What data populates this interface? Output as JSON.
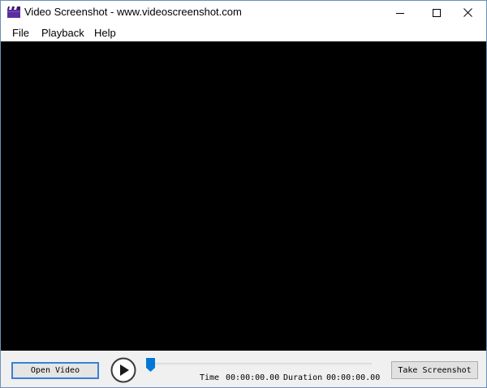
{
  "window": {
    "title": "Video Screenshot - www.videoscreenshot.com",
    "app_icon": "clapperboard-icon",
    "controls": {
      "minimize_icon": "minimize-icon",
      "maximize_icon": "maximize-icon",
      "close_icon": "close-icon"
    }
  },
  "menu": {
    "items": [
      {
        "label": "File"
      },
      {
        "label": "Playback"
      },
      {
        "label": "Help"
      }
    ]
  },
  "controls": {
    "open_label": "Open Video",
    "take_label": "Take Screenshot",
    "play_icon": "play-icon",
    "progress": 0,
    "time_label": "Time",
    "time_value": "00:00:00.00",
    "duration_label": "Duration",
    "duration_value": "00:00:00.00"
  },
  "colors": {
    "video_background": "#000000",
    "panel_background": "#f0f0f0",
    "accent": "#0078d7",
    "focus_border": "#3b7fd6"
  }
}
